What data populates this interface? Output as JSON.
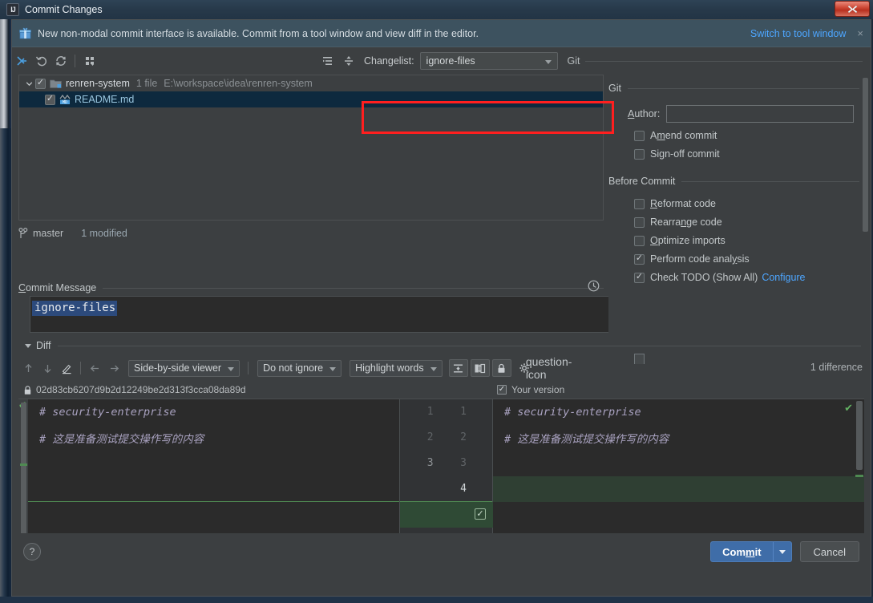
{
  "window": {
    "title": "Commit Changes",
    "app_icon": "intellij-idea-icon",
    "close_label": "✕"
  },
  "notification": {
    "icon": "gift-icon",
    "text": "New non-modal commit interface is available. Commit from a tool window and view diff in the editor.",
    "link": "Switch to tool window",
    "close": "×"
  },
  "toolbar": {
    "icons": [
      {
        "name": "show-diff-icon"
      },
      {
        "name": "rollback-icon"
      },
      {
        "name": "refresh-icon"
      },
      {
        "name": "group-by-icon"
      },
      {
        "name": "expand-all-icon"
      },
      {
        "name": "collapse-all-icon"
      }
    ],
    "changelist_label": "Changelist:",
    "changelist_value": "ignore-files",
    "changelist_options": [
      "ignore-files"
    ],
    "git_group_label": "Git"
  },
  "annotation": {
    "color": "#ff1f1f",
    "target": "changelist-selector"
  },
  "tree": {
    "root": {
      "name": "renren-system",
      "file_count": "1 file",
      "path": "E:\\workspace\\idea\\renren-system",
      "checked": true,
      "expanded": true,
      "icon": "folder-icon"
    },
    "children": [
      {
        "name": "README.md",
        "checked": true,
        "selected": true,
        "icon": "markdown-file-icon"
      }
    ]
  },
  "tree_status": {
    "branch_icon": "branch-icon",
    "branch": "master",
    "modified": "1 modified"
  },
  "commit_message": {
    "label": "Commit Message",
    "label_mnemonic": "C",
    "value": "ignore-files",
    "history_icon": "clock-icon",
    "selected": true
  },
  "options": {
    "git": {
      "title": "Git",
      "author_label": "Author:",
      "author_mnemonic": "A",
      "author_value": "",
      "checkboxes": [
        {
          "label": "Amend commit",
          "mnemonic": "m",
          "checked": false
        },
        {
          "label": "Sign-off commit",
          "mnemonic": "g",
          "checked": false
        }
      ]
    },
    "before_commit": {
      "title": "Before Commit",
      "checkboxes": [
        {
          "label": "Reformat code",
          "mnemonic": "R",
          "checked": false
        },
        {
          "label": "Rearrange code",
          "mnemonic": "n",
          "checked": false
        },
        {
          "label": "Optimize imports",
          "mnemonic": "O",
          "checked": false
        },
        {
          "label": "Perform code analysis",
          "mnemonic": "y",
          "checked": true
        },
        {
          "label": "Check TODO (Show All)",
          "checked": true,
          "link": "Configure"
        }
      ]
    }
  },
  "diff": {
    "section_title": "Diff",
    "toolbar": {
      "prev_diff_icon": "arrow-up-icon",
      "next_diff_icon": "arrow-down-icon",
      "edit_icon": "pencil-icon",
      "prev_pane_icon": "arrow-left-icon",
      "next_pane_icon": "arrow-right-icon",
      "viewer_mode": "Side-by-side viewer",
      "whitespace_mode": "Do not ignore",
      "highlight_mode": "Highlight words",
      "collapse_icon": "collapse-unchanged-icon",
      "columns_icon": "two-column-icon",
      "lock_icon": "lock-icon",
      "settings_icon": "gear-icon",
      "help_icon": "question-icon"
    },
    "difference_count": "1 difference",
    "left_header": {
      "lock_icon": "lock-icon",
      "revision": "02d83cb6207d9b2d12249be2d313f3cca08da89d"
    },
    "right_header": {
      "checked": true,
      "label": "Your version"
    },
    "left_lines": [
      {
        "num": "1",
        "text": "# security-enterprise",
        "type": "same"
      },
      {
        "num": "2",
        "text": "# 这是准备测试提交操作写的内容",
        "type": "same"
      },
      {
        "num": "3",
        "text": "",
        "type": "same"
      },
      {
        "num": "",
        "text": "",
        "type": "empty"
      }
    ],
    "right_lines": [
      {
        "num": "1",
        "text": "# security-enterprise",
        "type": "same"
      },
      {
        "num": "2",
        "text": "# 这是准备测试提交操作写的内容",
        "type": "same"
      },
      {
        "num": "3",
        "text": "",
        "type": "same"
      },
      {
        "num": "4",
        "text": "",
        "type": "added",
        "accept": true
      }
    ]
  },
  "footer": {
    "help": "?",
    "commit": "Commit",
    "commit_mnemonic": "m",
    "cancel": "Cancel"
  },
  "colors": {
    "accent_blue": "#4da6ff",
    "commit_button": "#3f6da8",
    "annotation_red": "#ff1f1f",
    "added_green": "#2f4a35",
    "panel_bg": "#3c3f41",
    "editor_bg": "#2b2b2b"
  }
}
